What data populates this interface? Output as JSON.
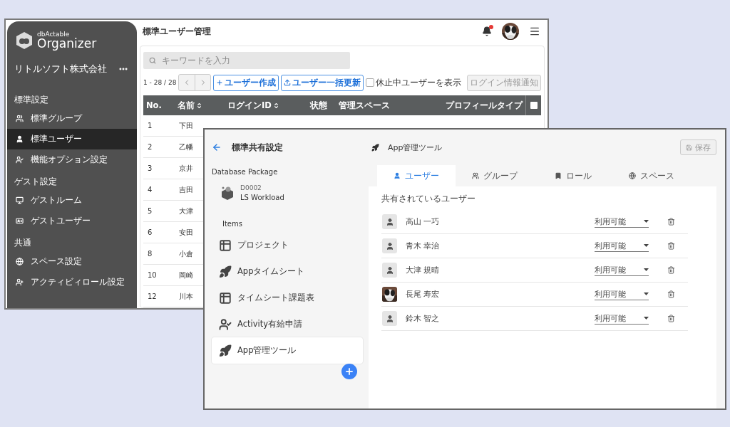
{
  "back_window": {
    "sidebar": {
      "product": "dbActable",
      "app_name": "Organizer",
      "company": "リトルソフト株式会社",
      "sections": [
        {
          "title": "標準設定",
          "items": [
            {
              "label": "標準グループ",
              "kind": "group",
              "selected": false
            },
            {
              "label": "標準ユーザー",
              "kind": "user",
              "selected": true
            },
            {
              "label": "機能オプション設定",
              "kind": "usercheck",
              "selected": false
            }
          ]
        },
        {
          "title": "ゲスト設定",
          "items": [
            {
              "label": "ゲストルーム",
              "kind": "room",
              "selected": false
            },
            {
              "label": "ゲストユーザー",
              "kind": "card",
              "selected": false
            }
          ]
        },
        {
          "title": "共通",
          "items": [
            {
              "label": "スペース設定",
              "kind": "globe",
              "selected": false
            },
            {
              "label": "アクティビィロール設定",
              "kind": "userplus",
              "selected": false
            }
          ]
        }
      ]
    },
    "header": {
      "title": "標準ユーザー管理",
      "notification": true
    },
    "search": {
      "placeholder": "キーワードを入力"
    },
    "count": "1 - 28 / 28",
    "buttons": [
      {
        "label": "ユーザー作成",
        "kind": "plus"
      },
      {
        "label": "ユーザー一括更新",
        "kind": "upload"
      }
    ],
    "show_inactive": {
      "label": "休止中ユーザーを表示",
      "checked": false
    },
    "notify_button": {
      "label": "ログイン情報通知",
      "disabled": true
    },
    "table": {
      "select_all": {
        "checked": false
      },
      "columns": [
        {
          "label": "No.",
          "sortable": false
        },
        {
          "label": "名前",
          "sortable": true
        },
        {
          "label": "ログインID",
          "sortable": true
        },
        {
          "label": "状態",
          "sortable": false
        },
        {
          "label": "管理スペース",
          "sortable": false
        },
        {
          "label": "プロフィールタイプ",
          "sortable": false
        }
      ],
      "rows": [
        {
          "no": "1",
          "name": "下田"
        },
        {
          "no": "2",
          "name": "乙幡"
        },
        {
          "no": "3",
          "name": "京井"
        },
        {
          "no": "4",
          "name": "吉田"
        },
        {
          "no": "5",
          "name": "大津"
        },
        {
          "no": "6",
          "name": "安田"
        },
        {
          "no": "8",
          "name": "小倉"
        },
        {
          "no": "10",
          "name": "岡崎"
        },
        {
          "no": "12",
          "name": "川本"
        }
      ]
    }
  },
  "front_window": {
    "title": "標準共有設定",
    "package_heading": "Database Package",
    "package": {
      "code": "D0002",
      "name": "LS Workload"
    },
    "items_heading": "Items",
    "items": [
      {
        "label": "プロジェクト",
        "kind": "table",
        "selected": false
      },
      {
        "label": "Appタイムシート",
        "kind": "rocket",
        "selected": false
      },
      {
        "label": "タイムシート課題表",
        "kind": "table",
        "selected": false
      },
      {
        "label": "Activity有給申請",
        "kind": "usercheck",
        "selected": false
      },
      {
        "label": "App管理ツール",
        "kind": "rocket",
        "selected": true
      }
    ],
    "detail_title": "App管理ツール",
    "save_button": {
      "label": "保存",
      "disabled": true
    },
    "tabs": [
      {
        "label": "ユーザー",
        "kind": "user",
        "selected": true
      },
      {
        "label": "グループ",
        "kind": "group",
        "selected": false
      },
      {
        "label": "ロール",
        "kind": "bookmark",
        "selected": false
      },
      {
        "label": "スペース",
        "kind": "globe",
        "selected": false
      }
    ],
    "shared_heading": "共有されているユーザー",
    "users": [
      {
        "name": "高山 一巧",
        "kind": "default",
        "permission": "利用可能"
      },
      {
        "name": "青木 幸治",
        "kind": "default",
        "permission": "利用可能"
      },
      {
        "name": "大津 規晴",
        "kind": "default",
        "permission": "利用可能"
      },
      {
        "name": "長尾 寿宏",
        "permission": "利用可能"
      },
      {
        "name": "鈴木 智之",
        "kind": "default",
        "permission": "利用可能"
      }
    ]
  }
}
